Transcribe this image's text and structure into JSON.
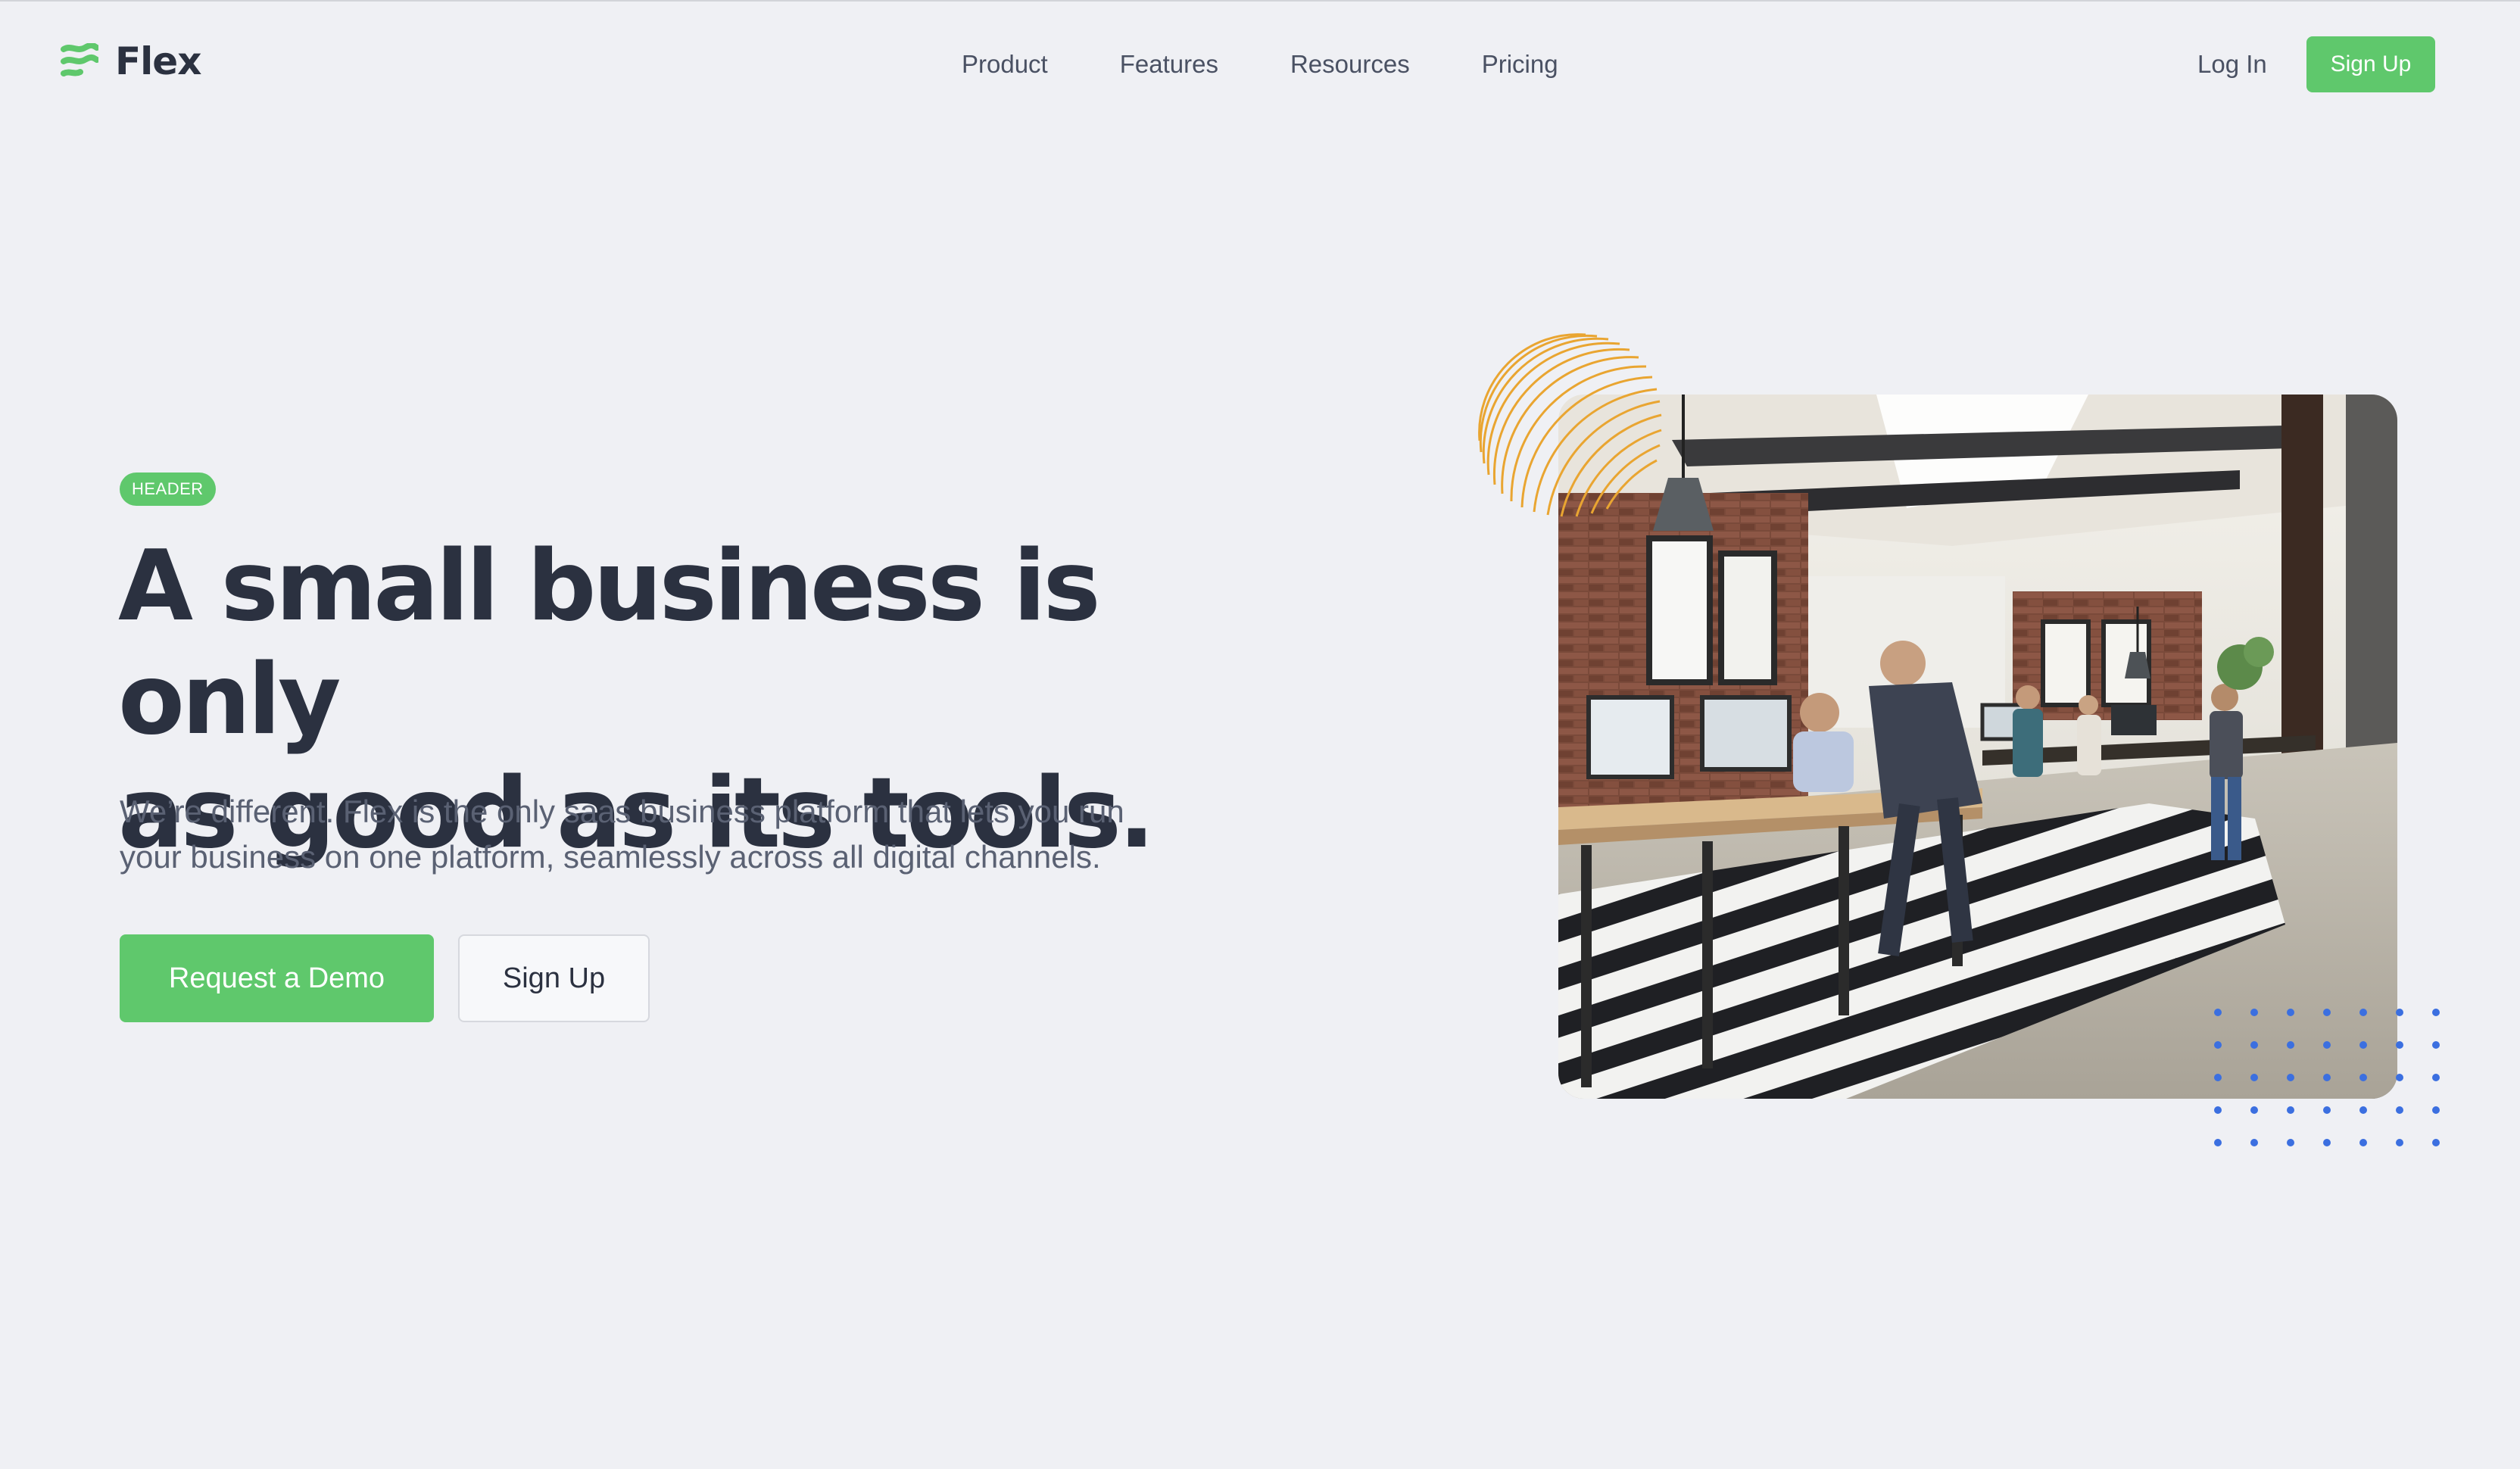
{
  "brand": {
    "name": "Flex",
    "accent_color": "#5fc86c",
    "logo_icon": "wave-lines-icon"
  },
  "nav": {
    "links": [
      "Product",
      "Features",
      "Resources",
      "Pricing"
    ],
    "login_label": "Log In",
    "signup_label": "Sign Up"
  },
  "hero": {
    "badge": "HEADER",
    "headline_line1": "A small business is only",
    "headline_line2": "as good as its tools.",
    "subtext_line1": "We’re different. Flex is the only saas business platform that lets you run",
    "subtext_line2": "your business on one platform, seamlessly across all digital channels.",
    "primary_cta": "Request a Demo",
    "secondary_cta": "Sign Up",
    "image_subject": "open-plan office with people working at desks",
    "decorations": {
      "rings_color": "#e9a531",
      "dots_color": "#3b6fe0"
    }
  }
}
